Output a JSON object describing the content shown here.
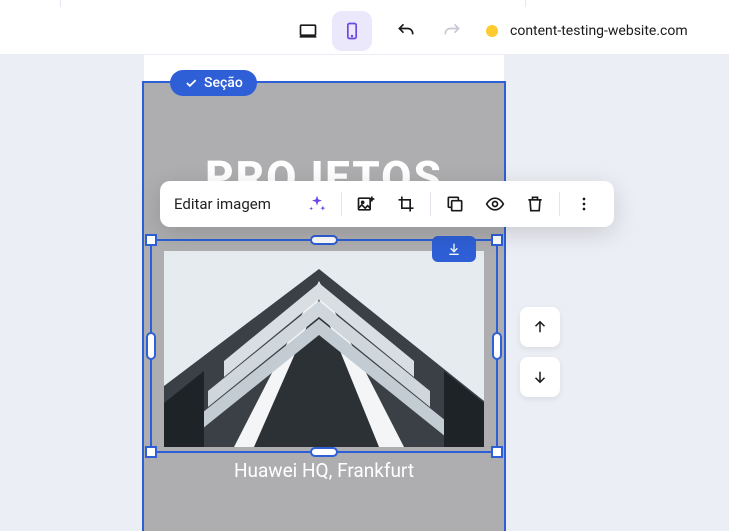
{
  "topbar": {
    "url": "content-testing-website.com",
    "status_color": "#ffcb2e"
  },
  "section": {
    "badge_label": "Seção",
    "hero_title": "PROJETOS",
    "image_caption": "Huawei HQ, Frankfurt"
  },
  "toolbar": {
    "edit_label": "Editar imagem"
  }
}
